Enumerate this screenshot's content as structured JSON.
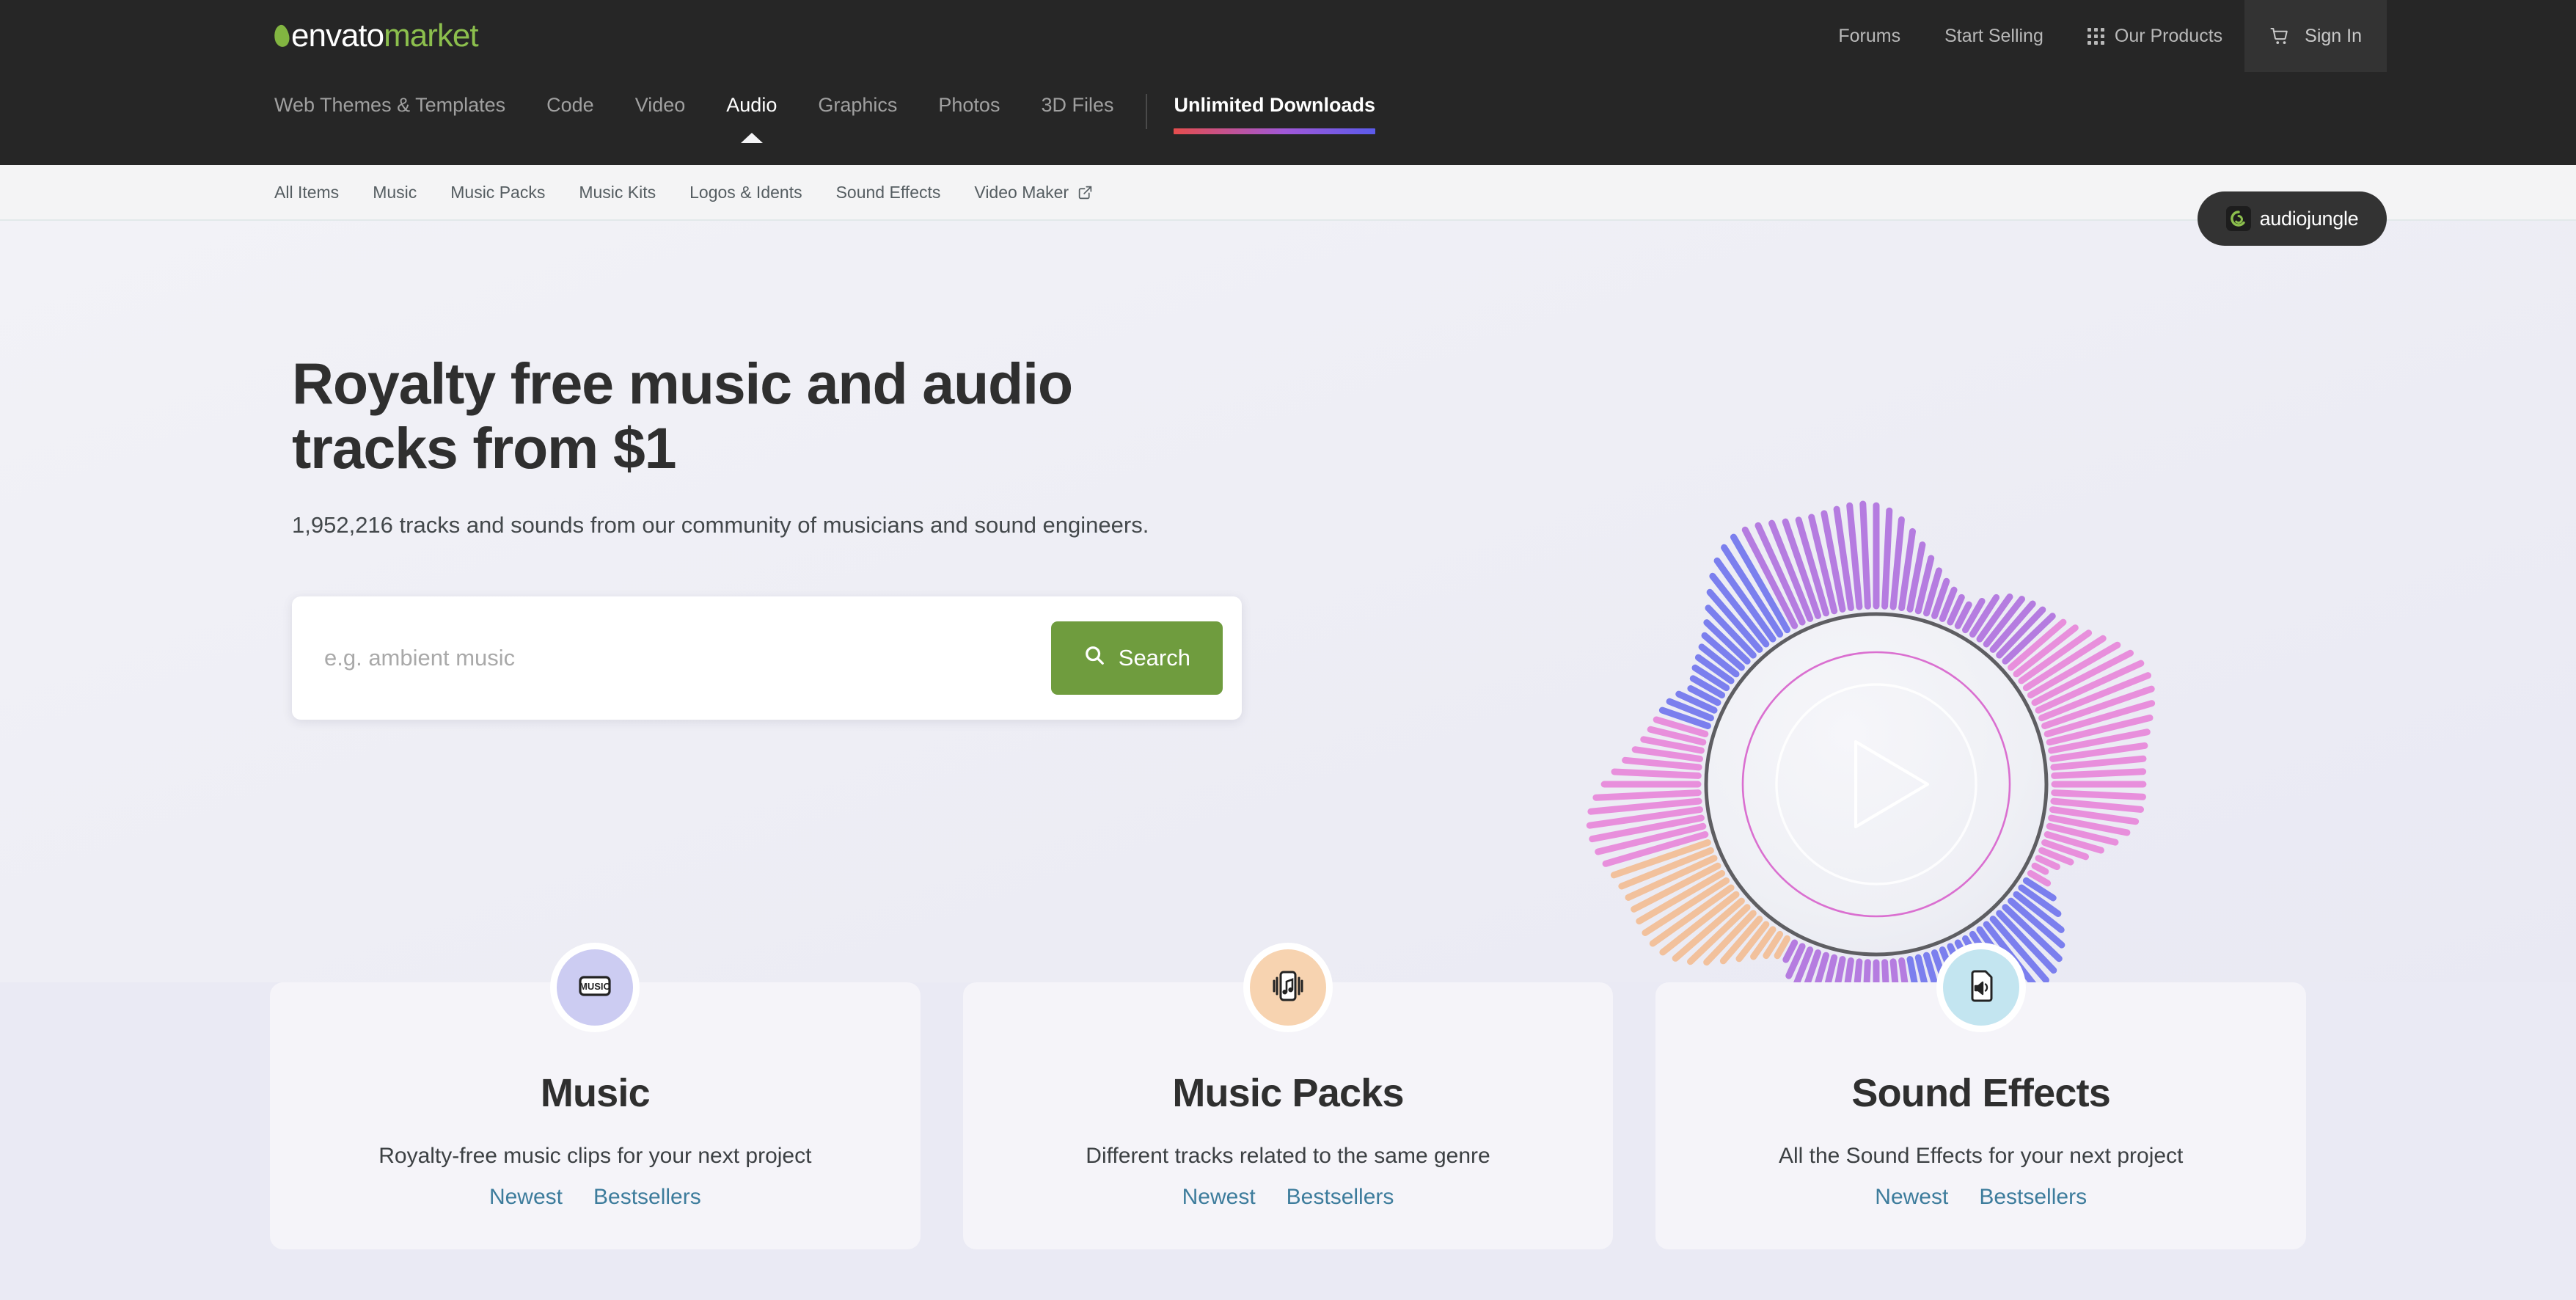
{
  "brand": {
    "envato": "envato",
    "market": "market"
  },
  "topbar": {
    "links": [
      {
        "label": "Forums",
        "icon": null
      },
      {
        "label": "Start Selling",
        "icon": null
      },
      {
        "label": "Our Products",
        "icon": "grid-dots-icon"
      }
    ],
    "signin": {
      "label": "Sign In",
      "icon": "cart-icon"
    }
  },
  "mainnav": {
    "items": [
      {
        "label": "Web Themes & Templates",
        "active": false
      },
      {
        "label": "Code",
        "active": false
      },
      {
        "label": "Video",
        "active": false
      },
      {
        "label": "Audio",
        "active": true
      },
      {
        "label": "Graphics",
        "active": false
      },
      {
        "label": "Photos",
        "active": false
      },
      {
        "label": "3D Files",
        "active": false
      }
    ],
    "unlimited": {
      "label": "Unlimited Downloads"
    }
  },
  "market_badge": {
    "label": "audiojungle"
  },
  "subnav": {
    "items": [
      {
        "label": "All Items",
        "external": false
      },
      {
        "label": "Music",
        "external": false
      },
      {
        "label": "Music Packs",
        "external": false
      },
      {
        "label": "Music Kits",
        "external": false
      },
      {
        "label": "Logos & Idents",
        "external": false
      },
      {
        "label": "Sound Effects",
        "external": false
      },
      {
        "label": "Video Maker",
        "external": true
      }
    ]
  },
  "hero": {
    "heading": "Royalty free music and audio tracks from $1",
    "subheading": "1,952,216 tracks and sounds from our community of musicians and sound engineers.",
    "search": {
      "placeholder": "e.g. ambient music",
      "value": "",
      "button_label": "Search",
      "button_icon": "search-icon"
    },
    "visual": {
      "play_icon": "play-triangle-icon",
      "label": "radial-audio-visualizer"
    }
  },
  "cards": [
    {
      "title": "Music",
      "description": "Royalty-free music clips for your next project",
      "icon": "music-label-icon",
      "badge_color": "#ccccf2",
      "links": [
        {
          "label": "Newest"
        },
        {
          "label": "Bestsellers"
        }
      ]
    },
    {
      "title": "Music Packs",
      "description": "Different tracks related to the same genre",
      "icon": "music-note-device-icon",
      "badge_color": "#f7d3b0",
      "links": [
        {
          "label": "Newest"
        },
        {
          "label": "Bestsellers"
        }
      ]
    },
    {
      "title": "Sound Effects",
      "description": "All the Sound Effects for your next project",
      "icon": "speaker-file-icon",
      "badge_color": "#c3e5f0",
      "links": [
        {
          "label": "Newest"
        },
        {
          "label": "Bestsellers"
        }
      ]
    }
  ],
  "colors": {
    "brand_green": "#8cbf4d",
    "search_button": "#6f9c3e",
    "link_blue": "#3d7c9c",
    "nav_dark": "#262626",
    "page_bg": "#eaeaf4",
    "card_bg": "#f5f4f9",
    "visualizer_blue": "#7b7fee",
    "visualizer_pink": "#e88fdc",
    "visualizer_purple": "#b57ce0",
    "visualizer_orange": "#f2c19c",
    "unlimited_gradient_start": "#e54d4d",
    "unlimited_gradient_end": "#5b5beb"
  }
}
